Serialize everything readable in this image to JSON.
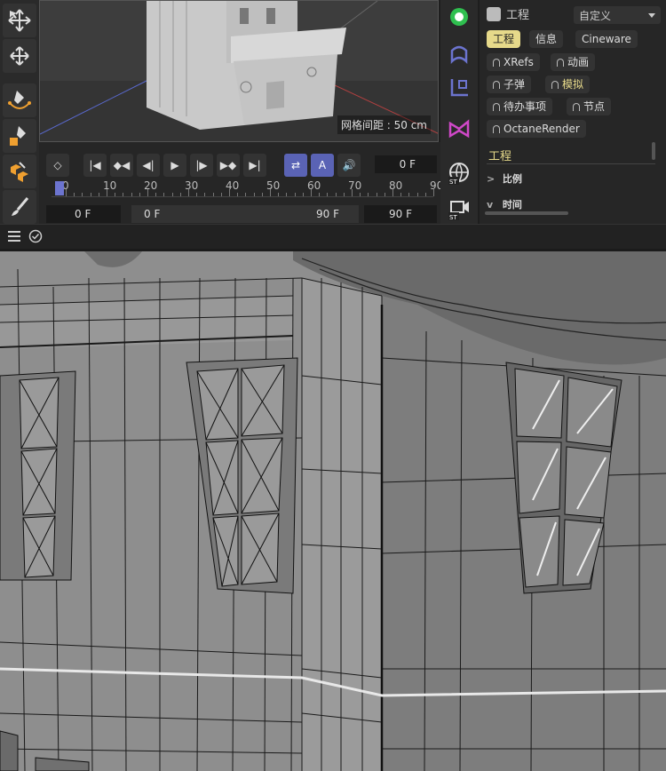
{
  "viewport": {
    "grid_readout": "网格间距 : 50 cm"
  },
  "attributes": {
    "header_label": "工程",
    "preset": "自定义",
    "tabs_row1": [
      "工程",
      "信息",
      "Cineware"
    ],
    "tabs_locked": [
      "XRefs",
      "动画",
      "子弹",
      "模拟",
      "待办事项",
      "节点",
      "OctaneRender"
    ],
    "section_title": "工程",
    "rows": [
      {
        "chevron": ">",
        "label": "比例"
      },
      {
        "chevron": "v",
        "label": "时间"
      }
    ]
  },
  "timeline": {
    "current_frame": "0 F",
    "ruler_labels": [
      "0",
      "10",
      "20",
      "30",
      "40",
      "50",
      "60",
      "70",
      "80",
      "90"
    ],
    "start_frame": "0 F",
    "range_start": "0 F",
    "range_end": "90 F",
    "end_frame": "90 F",
    "loop_label": "A"
  },
  "colors": {
    "accent_yellow": "#e6d98a",
    "accent_blue": "#5a63b5",
    "wire": "#1a1a1a",
    "gray_surface": "#8f8f8f"
  }
}
